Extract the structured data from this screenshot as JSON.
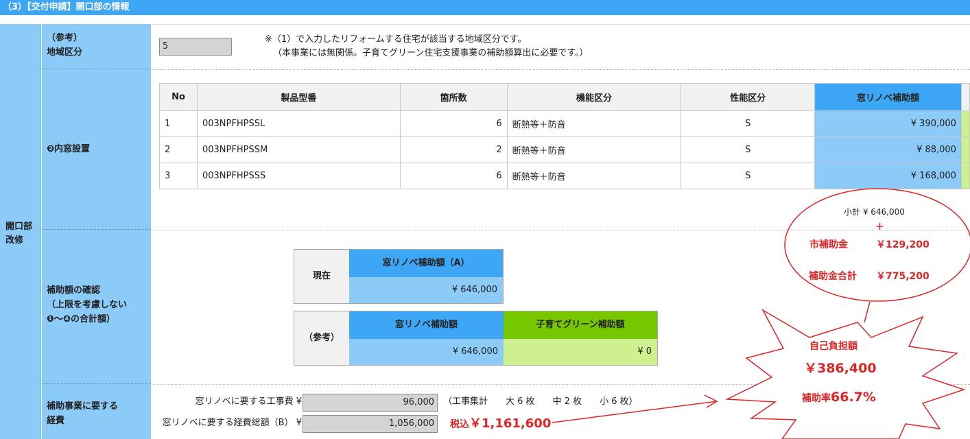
{
  "header": {
    "title": "（3）【交付申請】開口部の情報"
  },
  "sidebar": {
    "section_label": "開口部\n改修"
  },
  "region": {
    "label": "（参考）\n地域区分",
    "value": "5",
    "note_line1": "※（1）で入力したリフォームする住宅が該当する地域区分です。",
    "note_line2": "（本事業には無関係。子育てグリーン住宅支援事業の補助額算出に必要です。）"
  },
  "inner_window": {
    "label": "❷内窓設置",
    "columns": [
      "No",
      "製品型番",
      "箇所数",
      "機能区分",
      "性能区分",
      "窓リノベ補助額"
    ],
    "rows": [
      {
        "no": "1",
        "model": "003NPFHPSSL",
        "count": "6",
        "function": "断熱等＋防音",
        "grade": "S",
        "amount": "¥ 390,000"
      },
      {
        "no": "2",
        "model": "003NPFHPSSM",
        "count": "2",
        "function": "断熱等＋防音",
        "grade": "S",
        "amount": "¥ 88,000"
      },
      {
        "no": "3",
        "model": "003NPFHPSSS",
        "count": "6",
        "function": "断熱等＋防音",
        "grade": "S",
        "amount": "¥ 168,000"
      }
    ]
  },
  "confirm": {
    "label": "補助額の確認\n（上限を考慮しない\n❶〜❹の合計額）",
    "current_label": "現在",
    "current_header": "窓リノベ補助額（A）",
    "current_value": "¥ 646,000",
    "ref_label": "（参考）",
    "ref_header1": "窓リノベ補助額",
    "ref_header2": "子育てグリーン補助額",
    "ref_value1": "¥ 646,000",
    "ref_value2": "¥ 0"
  },
  "cost": {
    "label": "補助事業に要する\n経費",
    "work_label": "窓リノベに要する工事費 ¥",
    "work_value": "96,000",
    "work_note": "（工事集計　　大 6 枚　　中 2 枚　　小 6 枚）",
    "total_label": "窓リノベに要する経費総額（B） ¥",
    "total_value": "1,056,000"
  },
  "annotation": {
    "subtotal": "小計 ¥ 646,000",
    "plus": "＋",
    "city_label": "市補助金",
    "city_value": "￥129,200",
    "sum_label": "補助金合計",
    "sum_value": "￥775,200",
    "self_label": "自己負担額",
    "self_value": "￥386,400",
    "rate_label": "補助率",
    "rate_value": "66.7%",
    "tax_label": "税込",
    "tax_value": "￥1,161,600"
  },
  "colors": {
    "header_blue": "#3ea7f5",
    "label_blue": "#8ccbf8",
    "green": "#77c700",
    "light_green": "#cff08e",
    "annotation_red": "#e12424"
  }
}
